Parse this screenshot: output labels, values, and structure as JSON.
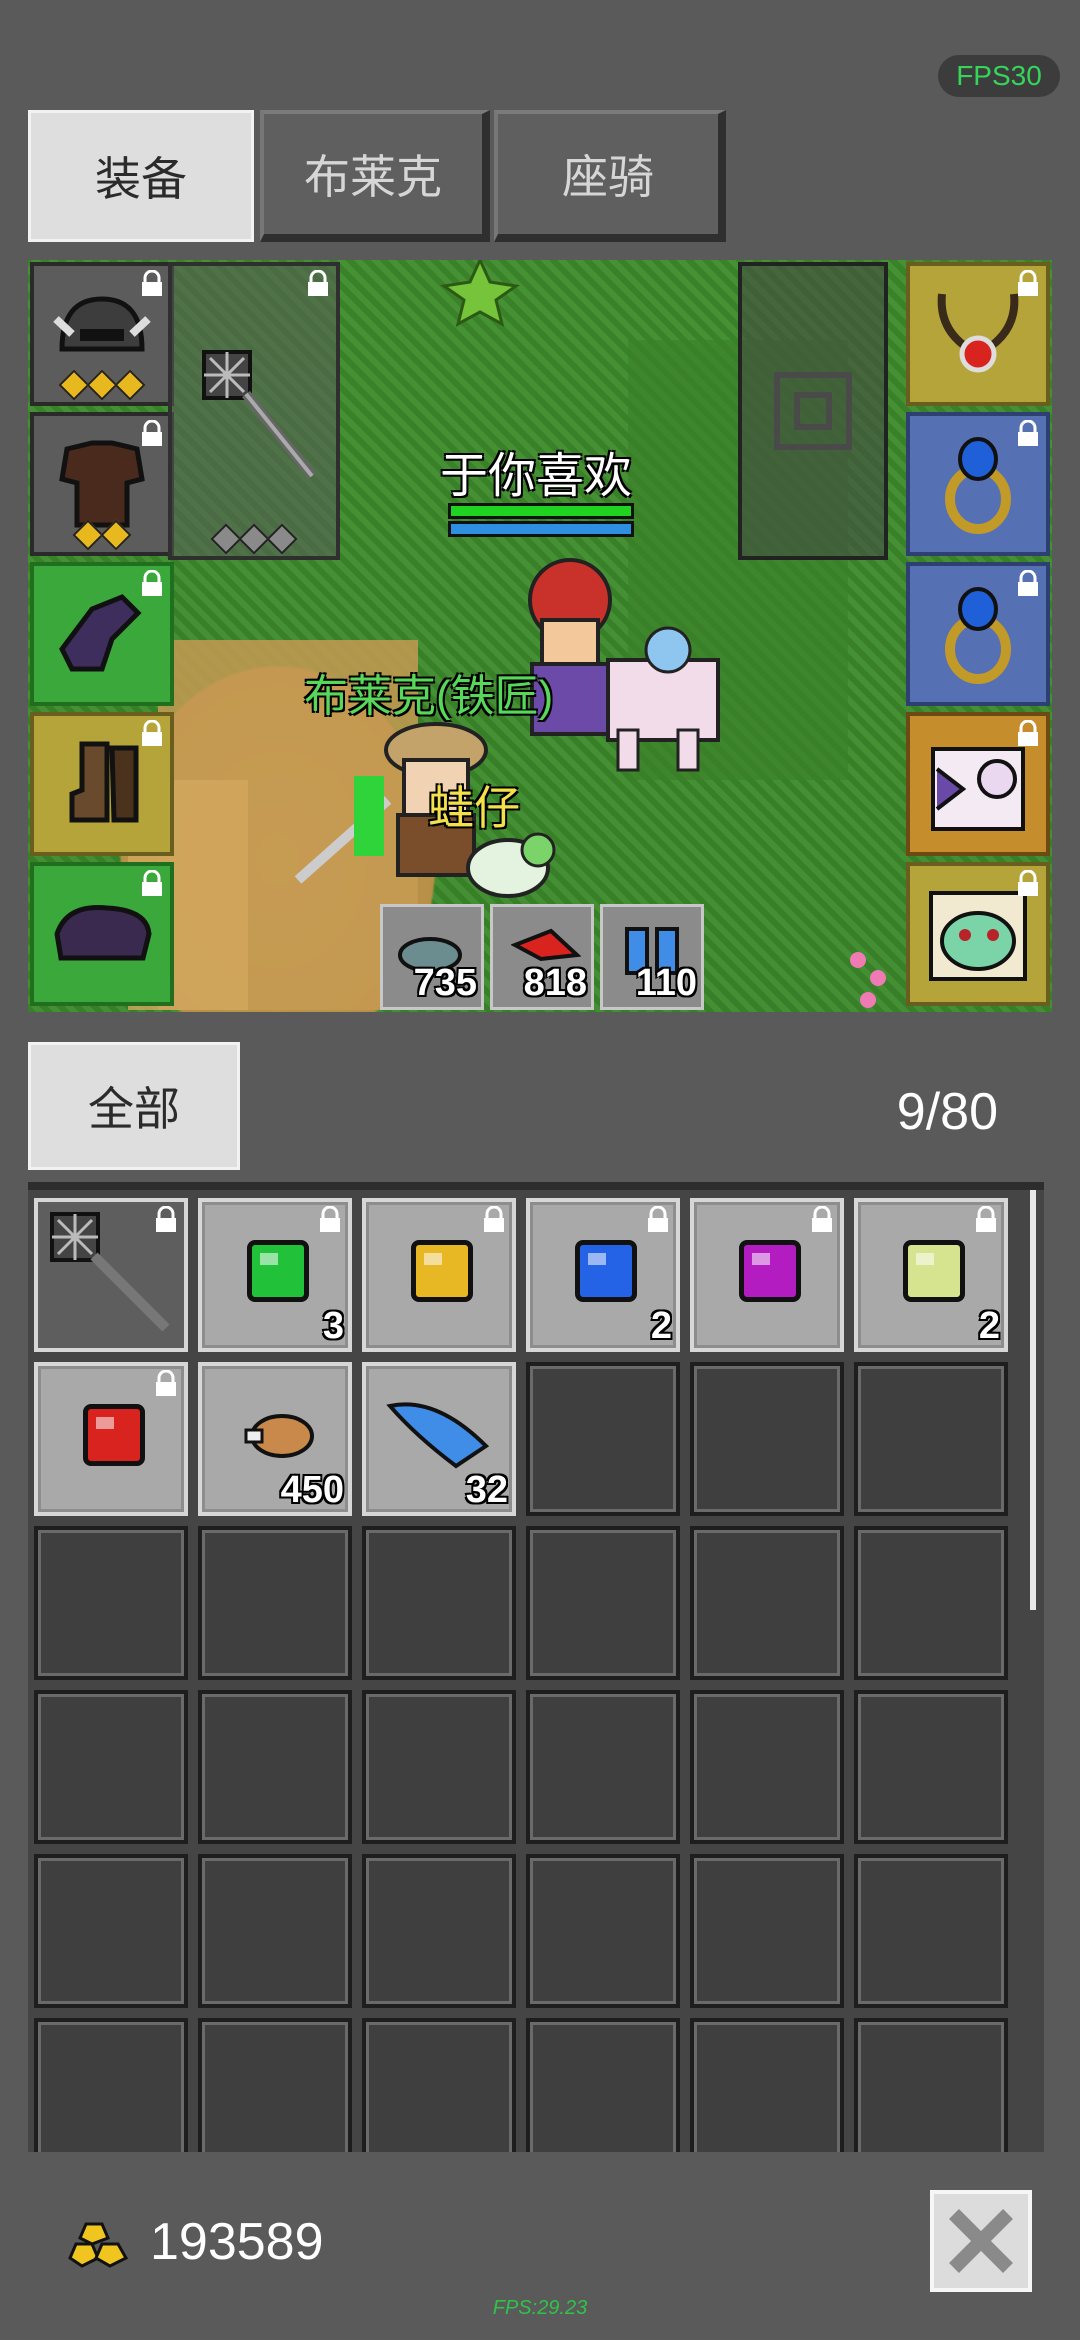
{
  "fps_badge": "FPS30",
  "tabs": [
    {
      "label": "装备",
      "active": true
    },
    {
      "label": "布莱克",
      "active": false
    },
    {
      "label": "座骑",
      "active": false
    }
  ],
  "scene": {
    "player_name": "于你喜欢",
    "npc_name": "布莱克(铁匠)",
    "pet_name": "蛙仔",
    "resources": [
      {
        "icon": "ore-icon",
        "value": "735"
      },
      {
        "icon": "red-feather-icon",
        "value": "818"
      },
      {
        "icon": "potion-icon",
        "value": "110"
      }
    ]
  },
  "equipment_left": [
    {
      "name": "helmet-icon",
      "rarity": "gray"
    },
    {
      "name": "armor-icon",
      "rarity": "gray"
    },
    {
      "name": "gloves-icon",
      "rarity": "green"
    },
    {
      "name": "boots-icon",
      "rarity": "yellow"
    },
    {
      "name": "cape-icon",
      "rarity": "green"
    }
  ],
  "equipment_right": [
    {
      "name": "necklace-icon",
      "rarity": "yellow"
    },
    {
      "name": "ring-icon",
      "rarity": "blue"
    },
    {
      "name": "ring-icon",
      "rarity": "blue"
    },
    {
      "name": "mount-icon",
      "rarity": "orange"
    },
    {
      "name": "pet-icon",
      "rarity": "yellow"
    }
  ],
  "filter": {
    "label": "全部"
  },
  "capacity": "9/80",
  "inventory": [
    {
      "type": "weapon",
      "qty": "",
      "color": ""
    },
    {
      "type": "gem",
      "qty": "3",
      "color": "#21c23a"
    },
    {
      "type": "gem",
      "qty": "",
      "color": "#e7b724"
    },
    {
      "type": "gem",
      "qty": "2",
      "color": "#2563e6"
    },
    {
      "type": "gem",
      "qty": "",
      "color": "#b21cc0"
    },
    {
      "type": "gem",
      "qty": "2",
      "color": "#d6e48f"
    },
    {
      "type": "gem",
      "qty": "",
      "color": "#d8231e"
    },
    {
      "type": "meat",
      "qty": "450",
      "color": "#c8894a"
    },
    {
      "type": "feather",
      "qty": "32",
      "color": "#3f8de6"
    }
  ],
  "gold": "193589",
  "fps_bottom": "FPS:29.23"
}
